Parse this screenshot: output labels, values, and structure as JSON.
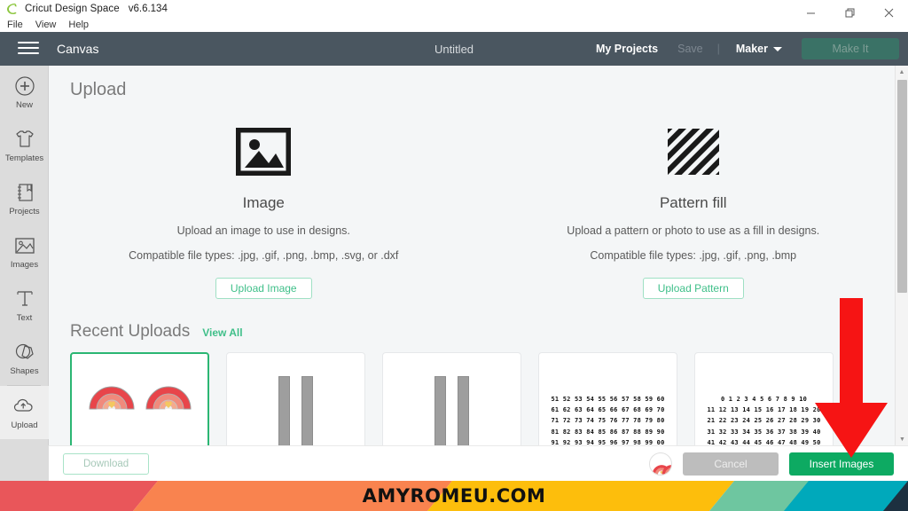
{
  "window": {
    "app_name": "Cricut Design Space",
    "version": "v6.6.134",
    "menus": [
      "File",
      "View",
      "Help"
    ],
    "controls": [
      "minimize",
      "maximize",
      "close"
    ]
  },
  "header": {
    "canvas_label": "Canvas",
    "doc_title": "Untitled",
    "my_projects": "My Projects",
    "save": "Save",
    "separator": "|",
    "machine": "Maker",
    "make_it": "Make It",
    "bg_color": "#4a5660",
    "make_it_color": "#3a7266"
  },
  "sidebar": {
    "items": [
      {
        "label": "New",
        "icon": "plus-circle-icon",
        "active": false
      },
      {
        "label": "Templates",
        "icon": "tshirt-icon",
        "active": false
      },
      {
        "label": "Projects",
        "icon": "notebook-icon",
        "active": false
      },
      {
        "label": "Images",
        "icon": "photo-icon",
        "active": false
      },
      {
        "label": "Text",
        "icon": "text-t-icon",
        "active": false
      },
      {
        "label": "Shapes",
        "icon": "shapes-icon",
        "active": false
      },
      {
        "label": "Upload",
        "icon": "cloud-upload-icon",
        "active": true
      }
    ]
  },
  "panel": {
    "title": "Upload",
    "columns": [
      {
        "icon": "image-placeholder-icon",
        "title": "Image",
        "description": "Upload an image to use in designs.",
        "types": "Compatible file types: .jpg, .gif, .png, .bmp, .svg, or .dxf",
        "button": "Upload Image"
      },
      {
        "icon": "diagonal-stripes-icon",
        "title": "Pattern fill",
        "description": "Upload a pattern or photo to use as a fill in designs.",
        "types": "Compatible file types: .jpg, .gif, .png, .bmp",
        "button": "Upload Pattern"
      }
    ]
  },
  "recent": {
    "title": "Recent Uploads",
    "view_all": "View All",
    "accent_color": "#3fbf89",
    "thumbnails": [
      {
        "kind": "rainbows",
        "selected": true
      },
      {
        "kind": "bars",
        "selected": false
      },
      {
        "kind": "bars",
        "selected": false
      },
      {
        "kind": "numbers",
        "selected": false,
        "rows": [
          "51 52 53 54 55 56 57 58 59 60",
          "61 62 63 64 65 66 67 68 69 70",
          "71 72 73 74 75 76 77 78 79 80",
          "81 82 83 84 85 86 87 88 89 90",
          "91 92 93 94 95 96 97 98 99 00"
        ]
      },
      {
        "kind": "numbers",
        "selected": false,
        "rows": [
          "0 1 2 3 4 5 6 7 8 9 10",
          "11 12 13 14 15 16 17 18 19 20",
          "21 22 23 24 25 26 27 28 29 30",
          "31 32 33 34 35 36 37 38 39 40",
          "41 42 43 44 45 46 47 48 49 50"
        ]
      }
    ]
  },
  "actions": {
    "download": "Download",
    "cancel": "Cancel",
    "insert": "Insert Images",
    "insert_color": "#0daa62",
    "cancel_color": "#bdbdbd"
  },
  "annotation": {
    "arrow": "red-down-arrow",
    "arrow_color": "#f61414"
  },
  "footer": {
    "text": "AMYROMEU.COM",
    "stripes": [
      "#e9565a",
      "#f9834f",
      "#fdbe0c",
      "#6ec6a0",
      "#00a9bb",
      "#1d3040"
    ]
  }
}
